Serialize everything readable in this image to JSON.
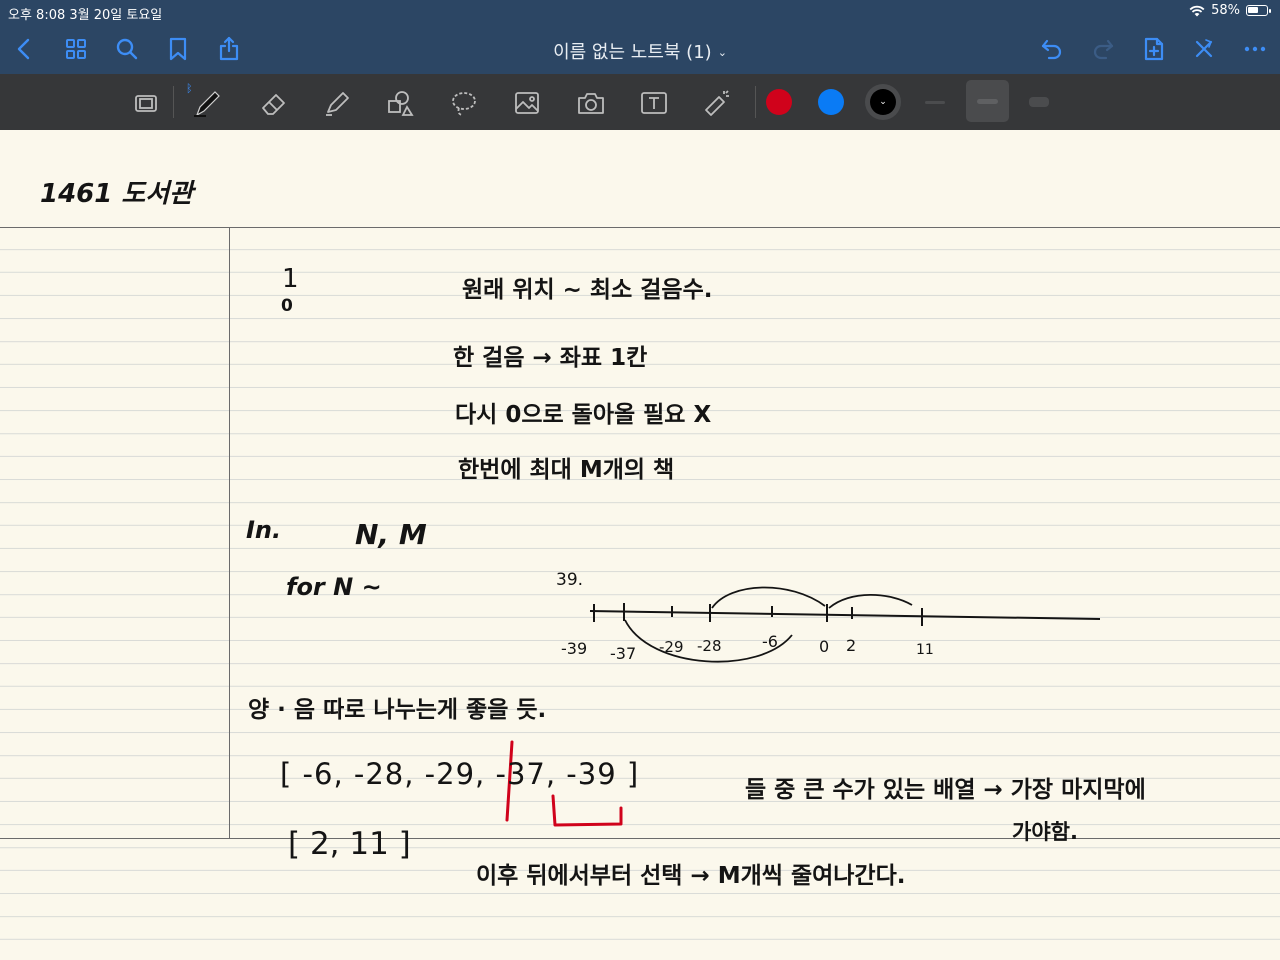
{
  "status_bar": {
    "time": "오후 8:08   3월 20일 토요일",
    "battery": "58%",
    "battery_level": 0.58
  },
  "nav": {
    "title": "이름 없는 노트북 (1)",
    "icons": [
      "back-icon",
      "thumbnails-icon",
      "search-icon",
      "bookmark-icon",
      "share-icon",
      "undo-icon",
      "redo-icon",
      "add-page-icon",
      "close-icon",
      "more-icon"
    ]
  },
  "toolbar": {
    "tools": [
      "read-mode-icon",
      "pen-icon",
      "eraser-icon",
      "highlighter-icon",
      "shapes-icon",
      "lasso-icon",
      "image-icon",
      "camera-icon",
      "text-icon",
      "laser-pointer-icon"
    ],
    "colors": [
      "#d0021b",
      "#0a7bf5",
      "#000000"
    ],
    "accent": "#2c4664"
  },
  "note": {
    "title": "1461 도서관",
    "lines": {
      "l1": "원래 위치 ~   최소 걸음수.",
      "l2": "한 걸음 → 좌표 1칸",
      "l3": "다시 0으로 돌아올 필요 X",
      "l4": "한번에 최대  M개의 책",
      "input_label": "In.",
      "input_vars": "N, M",
      "for_loop": "for N ~",
      "split_note": "양 · 음  따로 나누는게  좋을 듯.",
      "neg_array": "[ -6, -28, -29, -37, -39 ]",
      "pos_array": "[ 2, 11 ]",
      "far_note": "들 중 큰 수가 있는 배열 → 가장 마지막에",
      "far_note2": "가야함.",
      "after_note": "이후  뒤에서부터 선택 → M개씩 줄여나간다."
    },
    "marks": {
      "one": "1",
      "zero": "0"
    },
    "number_line": {
      "top_label": "39.",
      "ticks": [
        "-39",
        "-37",
        "-29",
        "-28",
        "-6",
        "0",
        "2",
        "11"
      ]
    }
  }
}
